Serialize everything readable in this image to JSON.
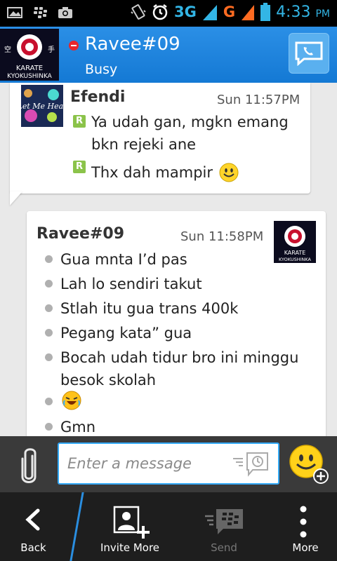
{
  "status_bar": {
    "network_3g": "3G",
    "network_g": "G",
    "time": "4:33",
    "ampm": "PM",
    "colors": {
      "accent": "#33b5e5",
      "g": "#ff6b21"
    }
  },
  "header": {
    "contact_name": "Ravee#09",
    "status": "Busy",
    "avatar_text_top": "KARATE",
    "avatar_text_bottom": "KYOKUSHINKA",
    "icons": {
      "status": "busy-icon",
      "call": "phone-icon"
    }
  },
  "messages": [
    {
      "sender": "Efendi",
      "time": "Sun 11:57PM",
      "avatar_text": "Let Me Hear",
      "lines": [
        {
          "text": "Ya udah gan, mgkn emang bkn rejeki ane",
          "badge": "R"
        },
        {
          "text": "Thx dah mampir",
          "badge": "R",
          "emoji": "smile"
        }
      ]
    },
    {
      "sender": "Ravee#09",
      "time": "Sun 11:58PM",
      "avatar_text_top": "KARATE",
      "avatar_text_bottom": "KYOKUSHINKA",
      "lines": [
        {
          "text": "Gua mnta I’d pas"
        },
        {
          "text": "Lah lo sendiri takut"
        },
        {
          "text": "Stlah itu gua trans 400k"
        },
        {
          "text": "Pegang kata” gua"
        },
        {
          "text": "Bocah udah tidur bro ini minggu besok skolah"
        },
        {
          "text": "",
          "emoji": "laugh"
        },
        {
          "text": "Gmn"
        }
      ]
    }
  ],
  "compose": {
    "placeholder": "Enter a message"
  },
  "bottom_bar": {
    "back": "Back",
    "invite_more": "Invite More",
    "send": "Send",
    "more": "More"
  }
}
